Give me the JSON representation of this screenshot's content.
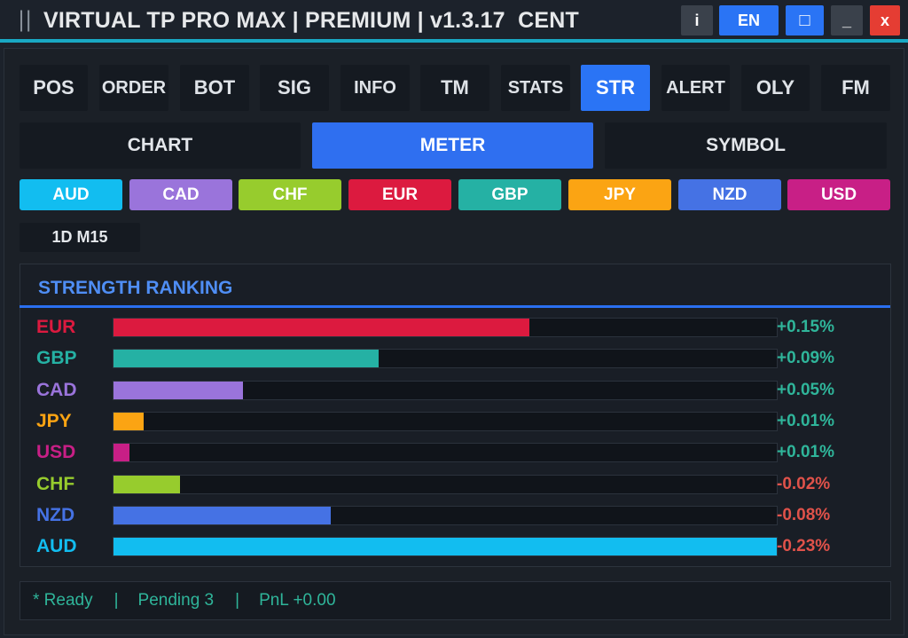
{
  "window": {
    "grip": "||",
    "title": "VIRTUAL TP PRO MAX | PREMIUM | v1.3.17  CENT",
    "buttons": {
      "info": "i",
      "lang": "EN",
      "restore": "□",
      "minimize": "_",
      "close": "x"
    }
  },
  "tabs": [
    {
      "label": "POS"
    },
    {
      "label": "ORDER"
    },
    {
      "label": "BOT"
    },
    {
      "label": "SIG"
    },
    {
      "label": "INFO"
    },
    {
      "label": "TM"
    },
    {
      "label": "STATS"
    },
    {
      "label": "STR",
      "active": true
    },
    {
      "label": "ALERT"
    },
    {
      "label": "OLY"
    },
    {
      "label": "FM"
    }
  ],
  "subtabs": [
    {
      "label": "CHART"
    },
    {
      "label": "METER",
      "active": true
    },
    {
      "label": "SYMBOL"
    }
  ],
  "currencies": [
    {
      "label": "AUD",
      "color": "#12bdf0"
    },
    {
      "label": "CAD",
      "color": "#9a74db"
    },
    {
      "label": "CHF",
      "color": "#97cc2d"
    },
    {
      "label": "EUR",
      "color": "#dc1a3f"
    },
    {
      "label": "GBP",
      "color": "#25b1a4"
    },
    {
      "label": "JPY",
      "color": "#fba413"
    },
    {
      "label": "NZD",
      "color": "#4572e4"
    },
    {
      "label": "USD",
      "color": "#c81f86"
    }
  ],
  "timeframe": "1D M15",
  "ranking": {
    "title": "STRENGTH RANKING",
    "rows": [
      {
        "currency": "EUR",
        "value_text": "+0.15%",
        "fill": 0.627,
        "color": "#dc1a3f"
      },
      {
        "currency": "GBP",
        "value_text": "+0.09%",
        "fill": 0.4,
        "color": "#25b1a4"
      },
      {
        "currency": "CAD",
        "value_text": "+0.05%",
        "fill": 0.195,
        "color": "#9a74db"
      },
      {
        "currency": "JPY",
        "value_text": "+0.01%",
        "fill": 0.045,
        "color": "#fba413"
      },
      {
        "currency": "USD",
        "value_text": "+0.01%",
        "fill": 0.024,
        "color": "#c81f86"
      },
      {
        "currency": "CHF",
        "value_text": "-0.02%",
        "fill": 0.1,
        "color": "#97cc2d"
      },
      {
        "currency": "NZD",
        "value_text": "-0.08%",
        "fill": 0.328,
        "color": "#4572e4"
      },
      {
        "currency": "AUD",
        "value_text": "-0.23%",
        "fill": 1.0,
        "color": "#12bdf0"
      }
    ],
    "positive_color": "#2fb59a",
    "negative_color": "#e0524a"
  },
  "status": {
    "ready": "* Ready",
    "sep": "|",
    "pending": "Pending 3",
    "pnl": "PnL +0.00"
  }
}
